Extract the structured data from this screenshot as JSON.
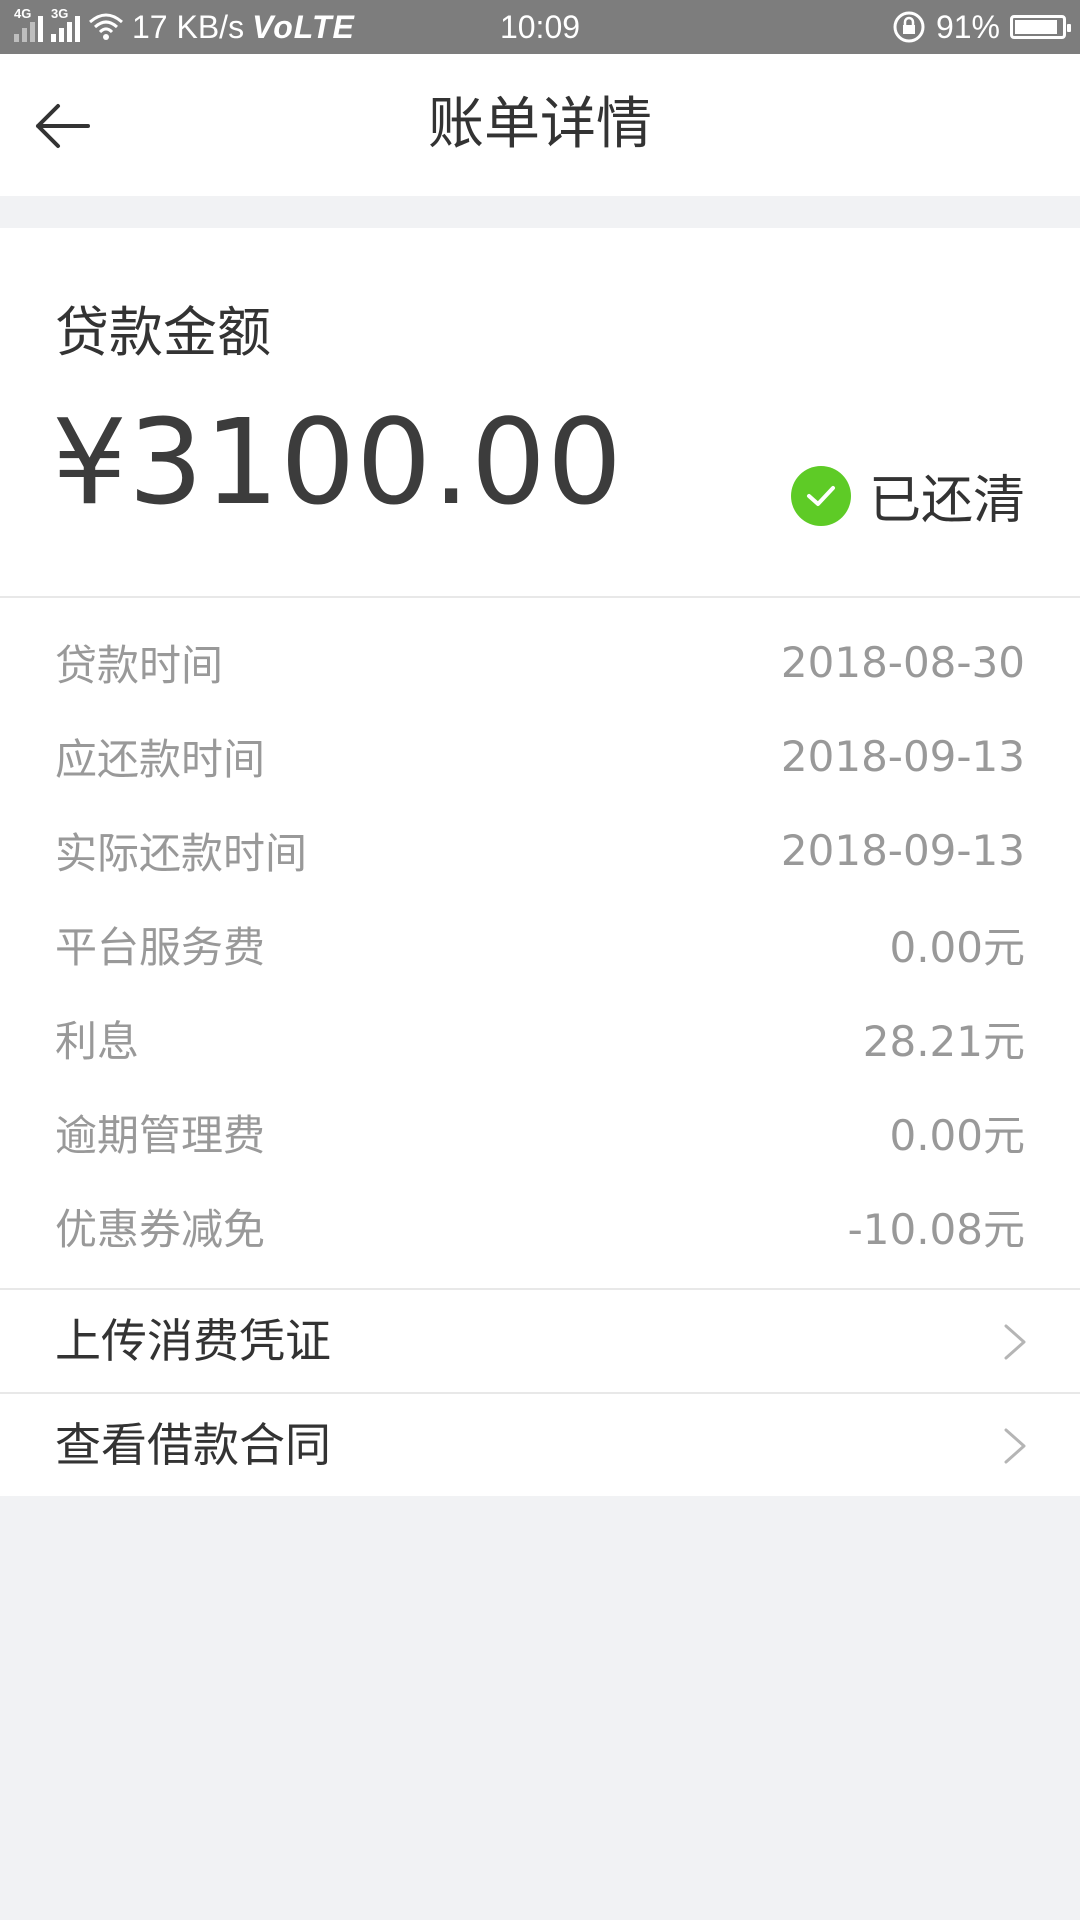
{
  "statusbar": {
    "signal1": "4G",
    "signal2": "3G",
    "net_speed": "17 KB/s",
    "volte": "VoLTE",
    "time": "10:09",
    "battery": "91%",
    "battery_level": 0.91
  },
  "header": {
    "title": "账单详情",
    "back_icon": "back-arrow-icon"
  },
  "loan": {
    "label": "贷款金额",
    "amount": "¥3100.00",
    "status": "已还清",
    "status_icon": "check-circle-icon",
    "status_color": "#5ecb26"
  },
  "details": [
    {
      "label": "贷款时间",
      "value": "2018-08-30"
    },
    {
      "label": "应还款时间",
      "value": "2018-09-13"
    },
    {
      "label": "实际还款时间",
      "value": "2018-09-13"
    },
    {
      "label": "平台服务费",
      "value": "0.00元"
    },
    {
      "label": "利息",
      "value": "28.21元"
    },
    {
      "label": "逾期管理费",
      "value": "0.00元"
    },
    {
      "label": "优惠券减免",
      "value": "-10.08元"
    }
  ],
  "links": [
    {
      "label": "上传消费凭证",
      "icon": "chevron-right-icon"
    },
    {
      "label": "查看借款合同",
      "icon": "chevron-right-icon"
    }
  ]
}
